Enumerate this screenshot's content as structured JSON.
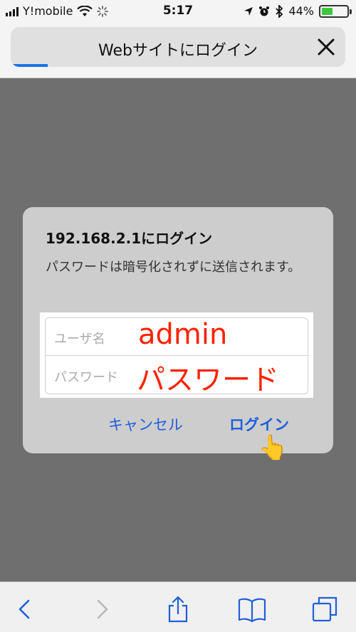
{
  "status_bar": {
    "carrier": "Y!mobile",
    "time": "5:17",
    "battery_percent_text": "44%",
    "battery_level": 0.44,
    "battery_color": "#3dc63f",
    "icons": [
      "signal-icon",
      "wifi-icon",
      "loading-spinner-icon",
      "location-arrow-icon",
      "alarm-icon",
      "bluetooth-icon",
      "battery-icon"
    ]
  },
  "browser": {
    "page_title": "Webサイトにログイン",
    "load_progress": 0.11,
    "accent_color": "#1a73e8",
    "close_icon": "close-icon"
  },
  "dialog": {
    "title": "192.168.2.1にログイン",
    "message": "パスワードは暗号化されずに送信されます。",
    "username": {
      "placeholder": "ユーザ名",
      "annotation": "admin"
    },
    "password": {
      "placeholder": "パスワード",
      "annotation": "パスワード"
    },
    "annotation_color": "#ff2200",
    "cancel_label": "キャンセル",
    "login_label": "ログイン",
    "pointer": "👆"
  },
  "toolbar": {
    "items": [
      "back-icon",
      "forward-icon",
      "share-icon",
      "bookmarks-icon",
      "tabs-icon"
    ]
  }
}
